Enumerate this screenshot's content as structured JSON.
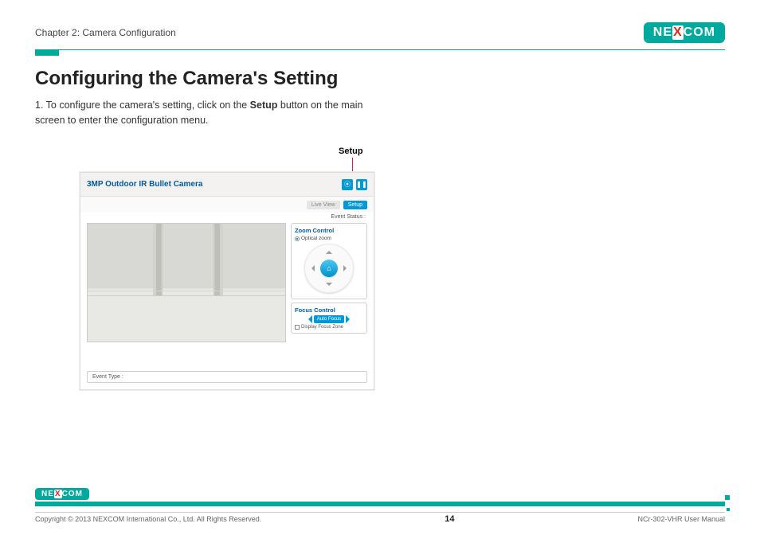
{
  "header": {
    "chapter": "Chapter 2: Camera Configuration",
    "brand_pre": "NE",
    "brand_x": "X",
    "brand_post": "COM"
  },
  "content": {
    "heading": "Configuring the Camera's Setting",
    "step1_pre": "1. To configure the camera's setting, click on the ",
    "step1_bold": "Setup",
    "step1_post": " button on the main screen to enter the configuration menu.",
    "callout": "Setup"
  },
  "screenshot": {
    "title": "3MP Outdoor IR Bullet Camera",
    "tab_inactive": "Live View",
    "tab_active": "Setup",
    "event_status": "Event Status :",
    "zoom": {
      "title": "Zoom Control",
      "optical": "Optical zoom"
    },
    "focus": {
      "title": "Focus Control",
      "button": "Auto Focus",
      "display_zone": "Display Focus Zone"
    },
    "event_type": "Event Type :"
  },
  "footer": {
    "copyright": "Copyright © 2013 NEXCOM International Co., Ltd. All Rights Reserved.",
    "page": "14",
    "manual": "NCr-302-VHR User Manual"
  }
}
